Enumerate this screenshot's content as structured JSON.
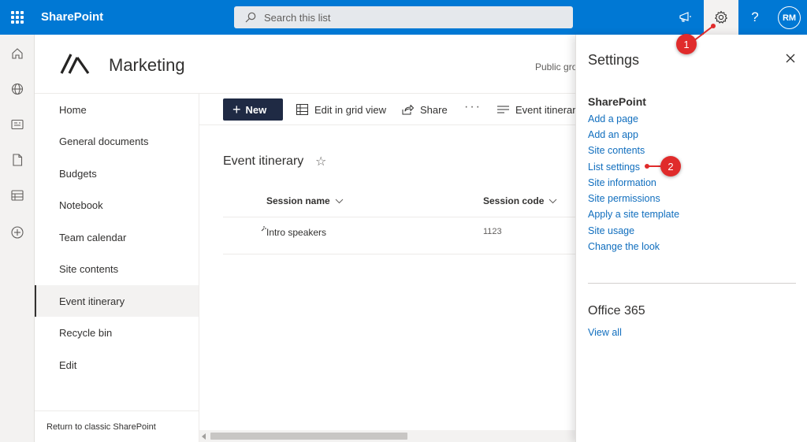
{
  "suitebar": {
    "brand": "SharePoint",
    "search_placeholder": "Search this list",
    "avatar_initials": "RM",
    "accent": "#0078d4"
  },
  "site": {
    "title": "Marketing",
    "privacy": "Public group"
  },
  "nav": {
    "items": [
      {
        "label": "Home"
      },
      {
        "label": "General documents"
      },
      {
        "label": "Budgets"
      },
      {
        "label": "Notebook"
      },
      {
        "label": "Team calendar"
      },
      {
        "label": "Site contents"
      },
      {
        "label": "Event itinerary",
        "selected": true
      },
      {
        "label": "Recycle bin"
      },
      {
        "label": "Edit"
      }
    ],
    "footer": "Return to classic SharePoint"
  },
  "commandbar": {
    "new_label": "New",
    "grid_label": "Edit in grid view",
    "share_label": "Share",
    "more_label": "···",
    "view_label": "Event itinerary"
  },
  "list": {
    "title": "Event itinerary",
    "columns": [
      "Session name",
      "Session code"
    ],
    "rows": [
      {
        "session_name": "Intro speakers",
        "session_code": "1123"
      }
    ]
  },
  "settings_panel": {
    "title": "Settings",
    "sharepoint_heading": "SharePoint",
    "links": [
      "Add a page",
      "Add an app",
      "Site contents",
      "List settings",
      "Site information",
      "Site permissions",
      "Apply a site template",
      "Site usage",
      "Change the look"
    ],
    "office_heading": "Office 365",
    "view_all": "View all"
  },
  "callouts": [
    "1",
    "2"
  ],
  "colors": {
    "callout": "#e02b2b",
    "link": "#106ebe",
    "new_button": "#1f2a44"
  }
}
